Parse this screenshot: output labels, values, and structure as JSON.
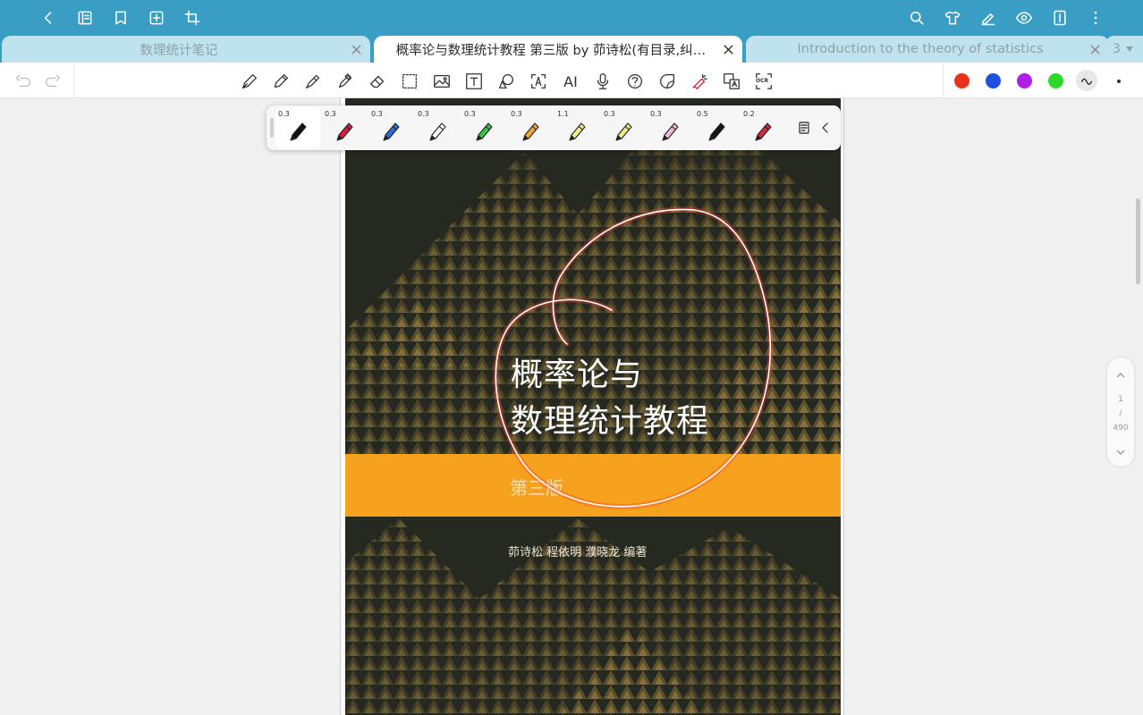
{
  "colors": {
    "topbar": "#3a9ec4",
    "tab_inactive": "#bfe3ee",
    "cover_dark": "#26291f",
    "cover_band": "#f6a21e",
    "annotation": "#ff3a2a"
  },
  "topbar": {
    "left_icons": [
      "back-arrow-icon",
      "outline-icon",
      "bookmark-icon",
      "add-page-icon",
      "crop-icon"
    ],
    "right_icons": [
      "search-icon",
      "shirt-icon",
      "pen-edit-icon",
      "eye-icon",
      "page-layout-icon",
      "more-icon"
    ]
  },
  "tabs": [
    {
      "title": "数理统计笔记",
      "active": false
    },
    {
      "title": "概率论与数理统计教程 第三版 by 茆诗松(有目录,纠…",
      "active": true
    },
    {
      "title": "Introduction to the theory of statistics",
      "active": false
    }
  ],
  "tab_count": "3",
  "toolbar": {
    "tools": [
      "fountain-pen-icon",
      "pencil-icon",
      "ballpoint-icon",
      "highlighter-icon",
      "eraser-icon",
      "lasso-select-icon",
      "image-icon",
      "text-box-icon",
      "shape-icon",
      "text-recognize-icon",
      "ai-icon",
      "microphone-icon",
      "audio-note-icon",
      "sticker-icon",
      "laser-pointer-icon",
      "translate-icon",
      "ocr-icon"
    ],
    "ai_label": "AI",
    "ocr_label": "OCR",
    "palette": [
      "#e8321c",
      "#1f4fe0",
      "#b01ee6",
      "#2ed82a"
    ]
  },
  "pen_tray": {
    "pens": [
      {
        "size": "0.3",
        "color": "#111111",
        "selected": true
      },
      {
        "size": "0.3",
        "color": "#d8203a",
        "selected": false
      },
      {
        "size": "0.3",
        "color": "#2a6bd8",
        "selected": false
      },
      {
        "size": "0.3",
        "color": "#ffffff",
        "selected": false
      },
      {
        "size": "0.3",
        "color": "#2ec84a",
        "selected": false
      },
      {
        "size": "0.3",
        "color": "#f2a632",
        "selected": false
      },
      {
        "size": "1.1",
        "color": "#f4ee8a",
        "selected": false
      },
      {
        "size": "0.3",
        "color": "#f2ea86",
        "selected": false
      },
      {
        "size": "0.3",
        "color": "#f0b8d8",
        "selected": false
      },
      {
        "size": "0.5",
        "color": "#151515",
        "selected": false
      },
      {
        "size": "0.2",
        "color": "#d4283e",
        "selected": false
      }
    ]
  },
  "cover": {
    "title_line1": "概率论与",
    "title_line2": "数理统计教程",
    "edition": "第三版",
    "authors": "茆诗松  程依明  濮晓龙  编著"
  },
  "page_nav": {
    "current": "1",
    "separator": "/",
    "total": "490"
  }
}
